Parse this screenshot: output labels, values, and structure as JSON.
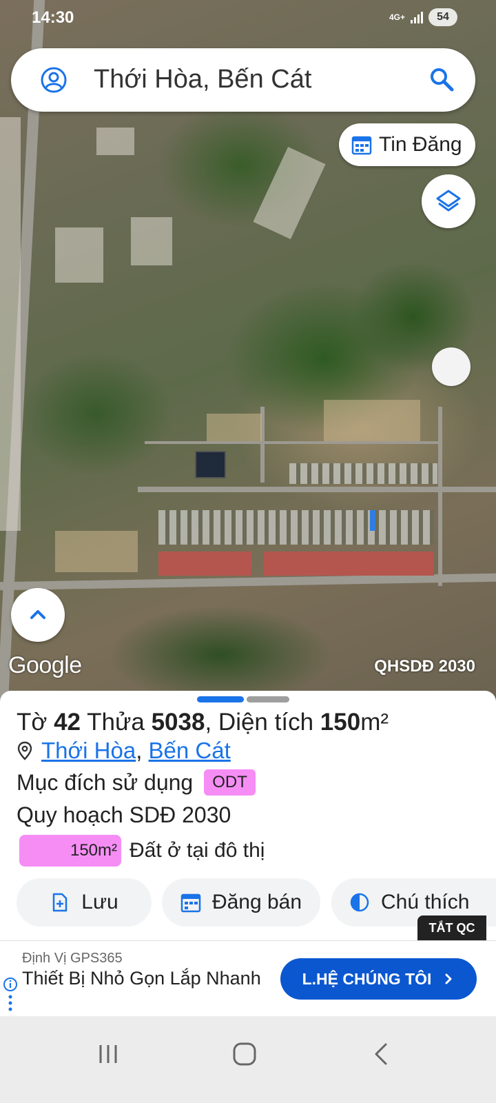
{
  "status": {
    "time": "14:30",
    "network": "4G+",
    "battery": "54"
  },
  "search": {
    "query": "Thới Hòa, Bến Cát"
  },
  "map": {
    "listings_button": "Tin Đăng",
    "watermark": "Google",
    "plan_label": "QHSDĐ 2030"
  },
  "parcel": {
    "sheet_prefix": "Tờ",
    "sheet_number": "42",
    "plot_prefix": "Thửa",
    "plot_number": "5038",
    "area_prefix": ", Diện tích",
    "area_value": "150",
    "area_unit": "m²",
    "location": {
      "ward": "Thới Hòa",
      "district": "Bến Cát",
      "separator": ","
    },
    "usage_label": "Mục đích sử dụng",
    "usage_code": "ODT",
    "plan_title": "Quy hoạch SDĐ 2030",
    "plan_area": "150m²",
    "plan_description": "Đất ở tại đô thị",
    "usage_color": "#f58df5"
  },
  "actions": [
    {
      "label": "Lưu",
      "icon": "add-file-icon"
    },
    {
      "label": "Đăng bán",
      "icon": "calendar-icon"
    },
    {
      "label": "Chú thích",
      "icon": "contrast-icon"
    }
  ],
  "ad": {
    "dismiss_label": "TẮT QC",
    "source": "Định Vị GPS365",
    "headline": "Thiết Bị Nhỏ Gọn Lắp Nhanh",
    "cta": "L.HỆ CHÚNG TÔI"
  },
  "colors": {
    "accent": "#1a73e8",
    "cta": "#0b57d0",
    "usage": "#f58df5"
  }
}
